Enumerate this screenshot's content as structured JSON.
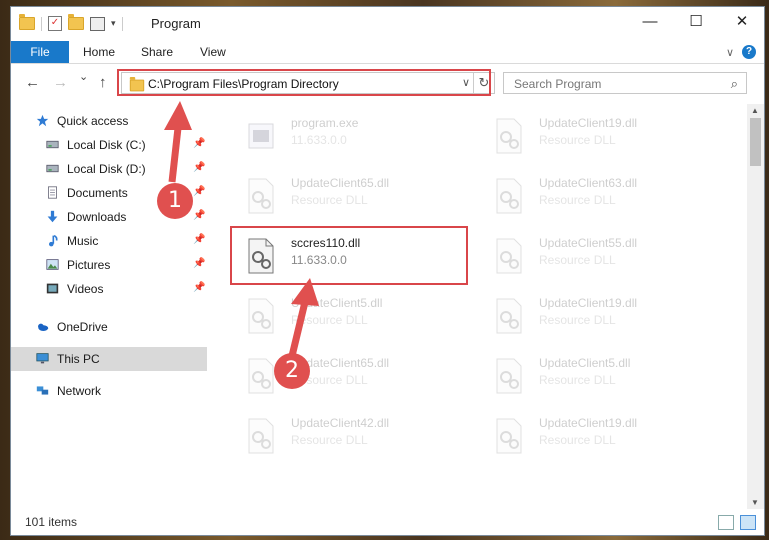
{
  "window": {
    "title": "Program",
    "minimize": "—",
    "maximize": "☐",
    "close": "✕"
  },
  "ribbon": {
    "file": "File",
    "home": "Home",
    "share": "Share",
    "view": "View",
    "expand": "∨",
    "help": "?"
  },
  "nav": {
    "back": "←",
    "forward": "→",
    "recent": "⌄",
    "up": "↑"
  },
  "address": {
    "path": "C:\\Program Files\\Program Directory",
    "dropdown": "∨",
    "refresh": "↻"
  },
  "search": {
    "placeholder": "Search Program",
    "icon": "⌕"
  },
  "sidebar": {
    "items": [
      {
        "label": "Quick access",
        "icon": "star-icon"
      },
      {
        "label": "Local Disk (C:)",
        "icon": "drive-icon"
      },
      {
        "label": "Local Disk (D:)",
        "icon": "drive-icon"
      },
      {
        "label": "Documents",
        "icon": "documents-icon"
      },
      {
        "label": "Downloads",
        "icon": "download-icon"
      },
      {
        "label": "Music",
        "icon": "music-icon"
      },
      {
        "label": "Pictures",
        "icon": "pictures-icon"
      },
      {
        "label": "Videos",
        "icon": "videos-icon"
      },
      {
        "label": "OneDrive",
        "icon": "cloud-icon"
      },
      {
        "label": "This PC",
        "icon": "monitor-icon"
      },
      {
        "label": "Network",
        "icon": "network-icon"
      }
    ],
    "pin": "📌"
  },
  "files": [
    {
      "name": "program.exe",
      "meta": "11.633.0.0"
    },
    {
      "name": "UpdateClient19.dll",
      "meta": "Resource DLL"
    },
    {
      "name": "UpdateClient65.dll",
      "meta": "Resource DLL"
    },
    {
      "name": "UpdateClient63.dll",
      "meta": "Resource DLL"
    },
    {
      "name": "sccres110.dll",
      "meta": "11.633.0.0"
    },
    {
      "name": "UpdateClient55.dll",
      "meta": "Resource DLL"
    },
    {
      "name": "UpdateClient5.dll",
      "meta": "Resource DLL"
    },
    {
      "name": "UpdateClient19.dll",
      "meta": "Resource DLL"
    },
    {
      "name": "UpdateClient65.dll",
      "meta": "Resource DLL"
    },
    {
      "name": "UpdateClient5.dll",
      "meta": "Resource DLL"
    },
    {
      "name": "UpdateClient42.dll",
      "meta": "Resource DLL"
    },
    {
      "name": "UpdateClient19.dll",
      "meta": "Resource DLL"
    }
  ],
  "status": {
    "count": "101 items"
  },
  "annotations": {
    "step1": "1",
    "step2": "2",
    "color": "#d9464a"
  },
  "colors": {
    "accent": "#1979ca",
    "selected": "#d9d9d9"
  }
}
